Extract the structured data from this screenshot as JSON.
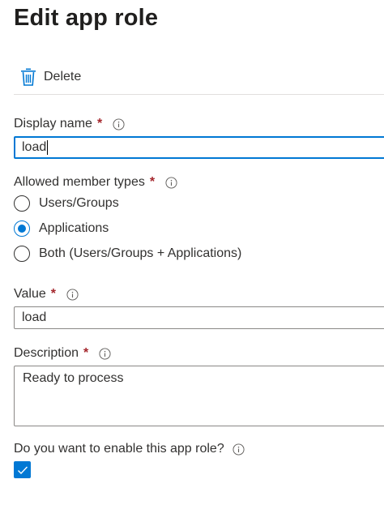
{
  "page": {
    "title": "Edit app role"
  },
  "toolbar": {
    "delete_label": "Delete",
    "delete_icon": "trash-icon"
  },
  "display_name": {
    "label": "Display name",
    "required_mark": "*",
    "value": "load"
  },
  "member_types": {
    "label": "Allowed member types",
    "required_mark": "*",
    "options": [
      {
        "label": "Users/Groups",
        "selected": false
      },
      {
        "label": "Applications",
        "selected": true
      },
      {
        "label": "Both (Users/Groups + Applications)",
        "selected": false
      }
    ]
  },
  "value_field": {
    "label": "Value",
    "required_mark": "*",
    "value": "load"
  },
  "description": {
    "label": "Description",
    "required_mark": "*",
    "value": "Ready to process"
  },
  "enable": {
    "label": "Do you want to enable this app role?",
    "checked": true
  },
  "colors": {
    "accent": "#0078d4",
    "required": "#a4262c",
    "border": "#8a8886",
    "text": "#323130"
  }
}
